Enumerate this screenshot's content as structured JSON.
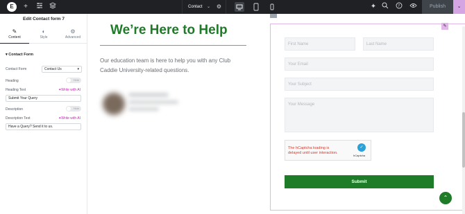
{
  "topbar": {
    "logo": "E",
    "page_name": "Contact",
    "publish_label": "Publish",
    "icons": [
      "add-icon",
      "settings-sliders-icon",
      "layers-icon",
      "chevron-down-icon",
      "gear-icon",
      "desktop-icon",
      "tablet-icon",
      "mobile-icon",
      "notes-icon",
      "search-icon",
      "help-icon",
      "preview-eye-icon"
    ]
  },
  "panel": {
    "title": "Edit Contact form 7",
    "tabs": [
      {
        "label": "Content",
        "icon": "pencil-icon"
      },
      {
        "label": "Style",
        "icon": "half-circle-icon"
      },
      {
        "label": "Advanced",
        "icon": "gear-icon"
      }
    ],
    "section": "Contact Form",
    "contact_form_label": "Contact Form",
    "contact_form_value": "Contact Us",
    "heading_label": "Heading",
    "heading_toggle": "Hide",
    "heading_text_label": "Heading Text",
    "ai_label": "Write with AI",
    "heading_text_value": "Submit Your Query",
    "description_label": "Description",
    "description_toggle": "Hide",
    "description_text_label": "Description Text",
    "description_text_value": "Have a Query? Send it to us."
  },
  "canvas": {
    "headline": "We’re Here to Help",
    "description": "Our education team is here to help you with any Club Caddie University-related questions.",
    "form": {
      "first_name": "First Name",
      "last_name": "Last Name",
      "email": "Your Email",
      "subject": "Your Subject",
      "message": "Your Message",
      "captcha_message": "The hCaptcha loading is delayed until user interaction.",
      "captcha_brand": "hCaptcha",
      "submit_label": "Submit"
    }
  },
  "colors": {
    "accent_green": "#1e7b27",
    "editor_dark": "#1f2124",
    "edit_highlight": "#e3b6ea",
    "ai_pink": "#c526b3"
  }
}
